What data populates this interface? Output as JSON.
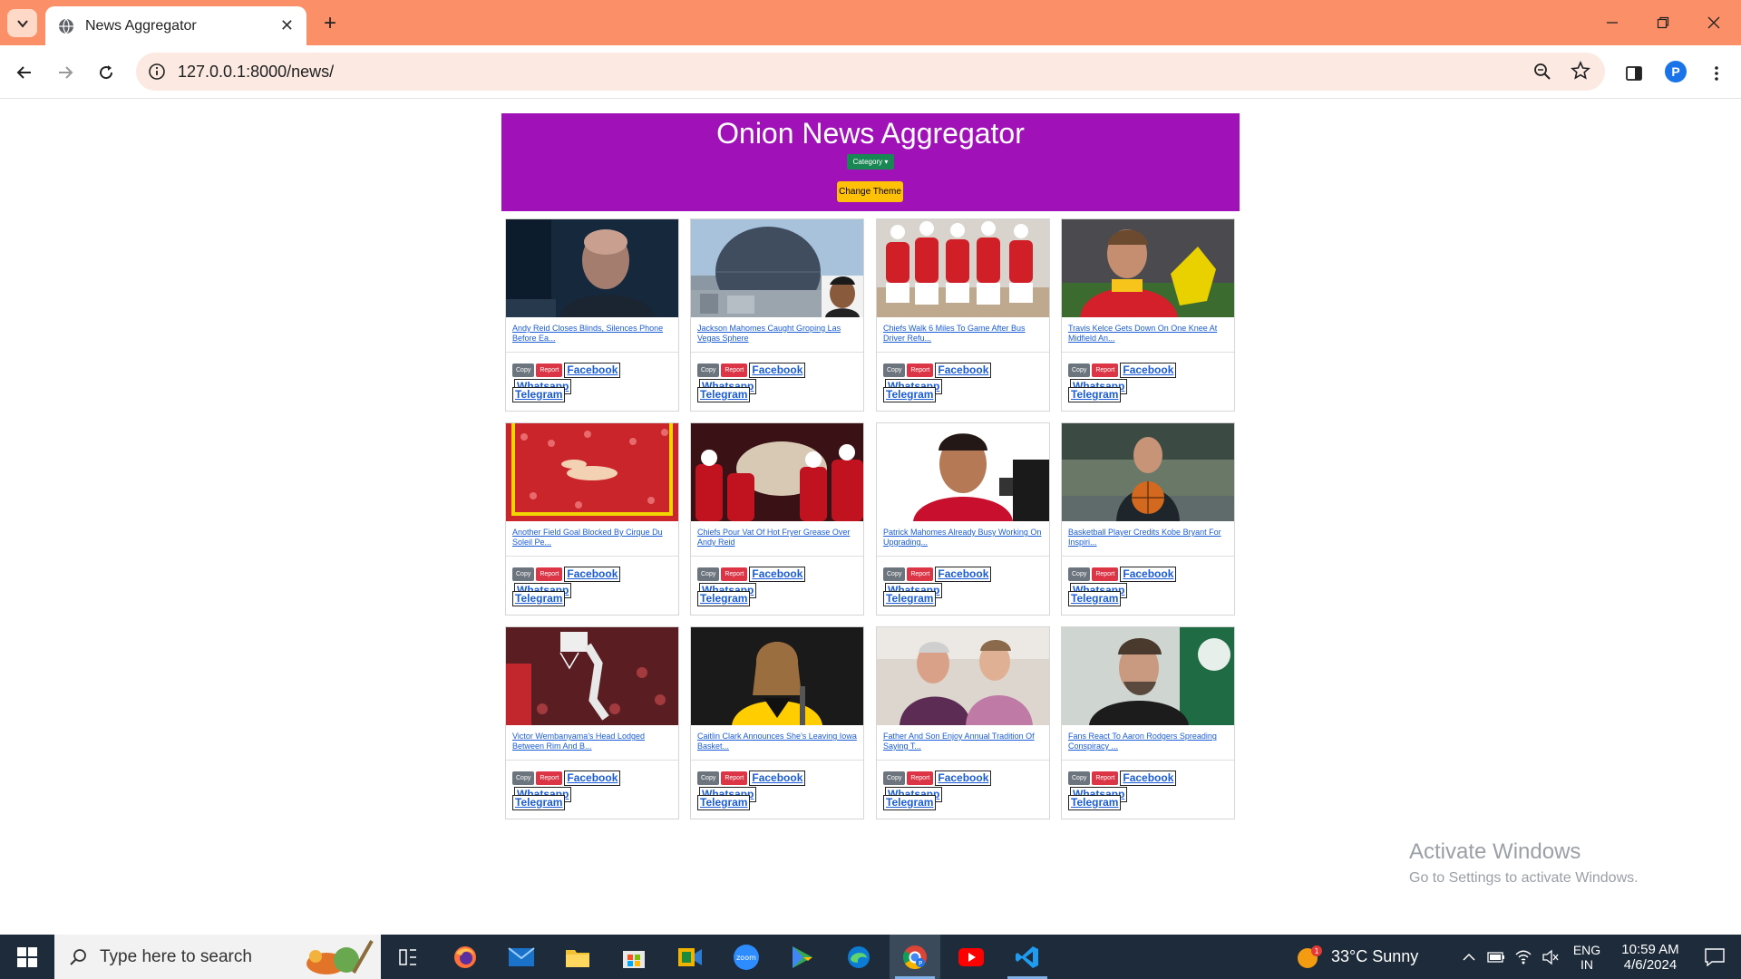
{
  "browser": {
    "tab_title": "News Aggregator",
    "url": "127.0.0.1:8000/news/",
    "profile_initial": "P",
    "accent": "#fb8f68"
  },
  "page": {
    "site_title": "Onion News Aggregator",
    "category_label": "Category ▾",
    "theme_label": "Change Theme",
    "header_color": "#a012b8",
    "buttons": {
      "copy": "Copy",
      "report": "Report",
      "facebook": "Facebook",
      "whatsapp": "Whatsapp",
      "telegram": "Telegram"
    },
    "articles": [
      {
        "headline": "Andy Reid Closes Blinds, Silences Phone Before Ea..."
      },
      {
        "headline": "Jackson Mahomes Caught Groping Las Vegas Sphere"
      },
      {
        "headline": "Chiefs Walk 6 Miles To Game After Bus Driver Refu..."
      },
      {
        "headline": "Travis Kelce Gets Down On One Knee At Midfield An..."
      },
      {
        "headline": "Another Field Goal Blocked By Cirque Du Soleil Pe..."
      },
      {
        "headline": "Chiefs Pour Vat Of Hot Fryer Grease Over Andy Reid"
      },
      {
        "headline": "Patrick Mahomes Already Busy Working On Upgrading..."
      },
      {
        "headline": "Basketball Player Credits Kobe Bryant For Inspiri..."
      },
      {
        "headline": "Victor Wembanyama's Head Lodged Between Rim And B..."
      },
      {
        "headline": "Caitlin Clark Announces She's Leaving Iowa Basket..."
      },
      {
        "headline": "Father And Son Enjoy Annual Tradition Of Saying T..."
      },
      {
        "headline": "Fans React To Aaron Rodgers Spreading Conspiracy ..."
      }
    ]
  },
  "watermark": {
    "line1": "Activate Windows",
    "line2": "Go to Settings to activate Windows."
  },
  "taskbar": {
    "search_placeholder": "Type here to search",
    "weather": "33°C  Sunny",
    "weather_badge": "1",
    "lang_line1": "ENG",
    "lang_line2": "IN",
    "time": "10:59 AM",
    "date": "4/6/2024"
  }
}
